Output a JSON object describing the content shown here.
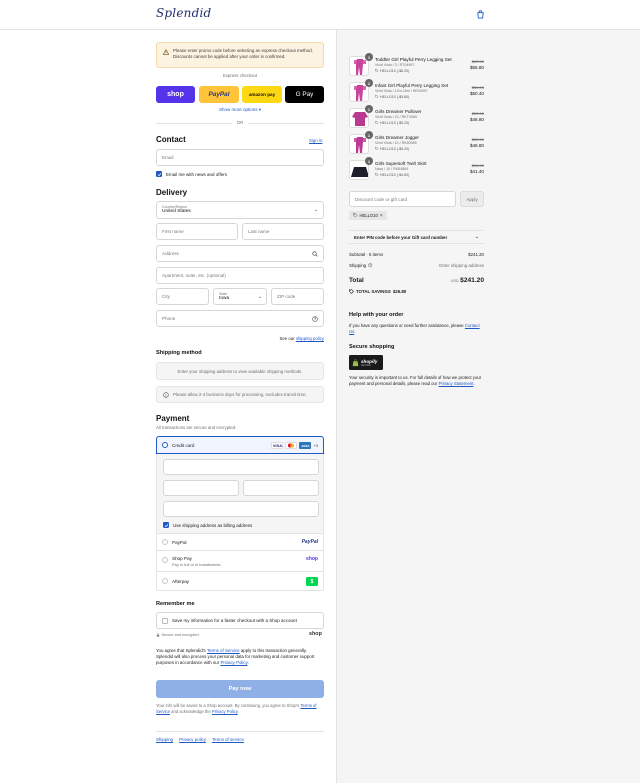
{
  "brand": {
    "logo_text": "Splendid"
  },
  "notice": {
    "text": "Please enter promo code before selecting an express checkout method. Discounts cannot be applied after your order is confirmed."
  },
  "express": {
    "label": "Express checkout",
    "shop_label": "shop",
    "paypal_label": "PayPal",
    "amazon_label": "amazon pay",
    "gpay_label": "G Pay",
    "more_label": "Show more options",
    "or_label": "OR"
  },
  "contact": {
    "heading": "Contact",
    "sign_in": "Sign in",
    "email_placeholder": "Email",
    "news_label": "Email me with news and offers"
  },
  "delivery": {
    "heading": "Delivery",
    "country_label": "Country/Region",
    "country_value": "United States",
    "first_name": "First name",
    "last_name": "Last name",
    "address": "Address",
    "apartment": "Apartment, suite, etc. (optional)",
    "city": "City",
    "state_label": "State",
    "state_value": "Iowa",
    "zip": "ZIP code",
    "phone": "Phone",
    "shipping_policy_prefix": "See our",
    "shipping_policy_link": "shipping policy"
  },
  "shipping_method": {
    "heading": "Shipping method",
    "placeholder": "Enter your shipping address to view available shipping methods.",
    "info": "Please allow 2-4 business days for processing, excludes transit time."
  },
  "payment": {
    "heading": "Payment",
    "subtext": "All transactions are secure and encrypted.",
    "credit_card": "Credit card",
    "card_badges": [
      "VISA",
      "MC",
      "AMEX"
    ],
    "more_cards": "+3",
    "billing_same": "Use shipping address as billing address",
    "paypal": "PayPal",
    "shop_pay": "Shop Pay",
    "shop_pay_sub": "Pay in full or in installments",
    "shop_badge": "shop",
    "afterpay": "Afterpay",
    "afterpay_badge": "$"
  },
  "remember": {
    "heading": "Remember me",
    "save_info": "Save my information for a faster checkout with a Shop account",
    "secure": "Secure and encrypted",
    "shop_logo": "shop"
  },
  "terms": {
    "p1": "You agree that Splendid's",
    "tos": "Terms of Service",
    "p2": "apply to this transaction generally. Splendid will also process your personal data for marketing and customer support purposes in accordance with our",
    "privacy": "Privacy Policy",
    "p3": "."
  },
  "pay_now": "Pay now",
  "shop_note": {
    "p1": "Your info will be saved to a Shop account. By continuing, you agree to Shop's",
    "tos": "Terms of Service",
    "p2": "and acknowledge the",
    "privacy": "Privacy Policy",
    "p3": "."
  },
  "footer": {
    "links": [
      "Shipping",
      "Privacy policy",
      "Terms of service"
    ]
  },
  "cart": {
    "items": [
      {
        "qty": "1",
        "name": "Toddler Girl Playful Perry Legging Set",
        "variant": "Vivid Viola / 3 / RT04997",
        "discount": "HELLO10 (-$6.20)",
        "old": "$62.00",
        "new": "$55.80",
        "color": "#c9449c"
      },
      {
        "qty": "1",
        "name": "Infant Girl Playful Perry Legging Set",
        "variant": "Vivid Viola / 12m-18m / RE04997",
        "discount": "HELLO10 (-$5.60)",
        "old": "$56.00",
        "new": "$50.40",
        "color": "#c9449c"
      },
      {
        "qty": "1",
        "name": "Girls Dreamer Pullover",
        "variant": "Vivid Viola / 10 / RKT0065",
        "discount": "HELLO10 (-$5.20)",
        "old": "$52.00",
        "new": "$46.80",
        "color": "#b93a90"
      },
      {
        "qty": "1",
        "name": "Girls Dreamer Jogger",
        "variant": "Vivid Viola / 10 / RK80065",
        "discount": "HELLO10 (-$5.20)",
        "old": "$52.00",
        "new": "$46.80",
        "color": "#b93a90"
      },
      {
        "qty": "1",
        "name": "Girls Supersoft Twirl Skirt",
        "variant": "Navy / 10 / RK84884",
        "discount": "HELLO10 (-$4.60)",
        "old": "$46.00",
        "new": "$41.40",
        "color": "#1d1d2b"
      }
    ],
    "discount_placeholder": "Discount code or gift card",
    "apply": "Apply",
    "applied_code": "HELLO10",
    "pin_label": "Enter PIN code before your Gift card number",
    "subtotal_label": "Subtotal · 5 items",
    "subtotal_value": "$241.20",
    "shipping_label": "Shipping",
    "shipping_value": "Enter shipping address",
    "total_label": "Total",
    "currency": "USD",
    "total_value": "$241.20",
    "savings_label": "TOTAL SAVINGS",
    "savings_value": "$26.80"
  },
  "help": {
    "heading": "Help with your order",
    "text": "If you have any questions or need further assistance, please",
    "link": "Contact Us",
    "secure_heading": "Secure shopping",
    "shopify_badge": "shopify",
    "shopify_sub": "SECURE",
    "secure_text": "Your security is important to us. For full details of how we protect your payment and personal details, please read our",
    "privacy_link": "Privacy Statement",
    "end": "."
  }
}
